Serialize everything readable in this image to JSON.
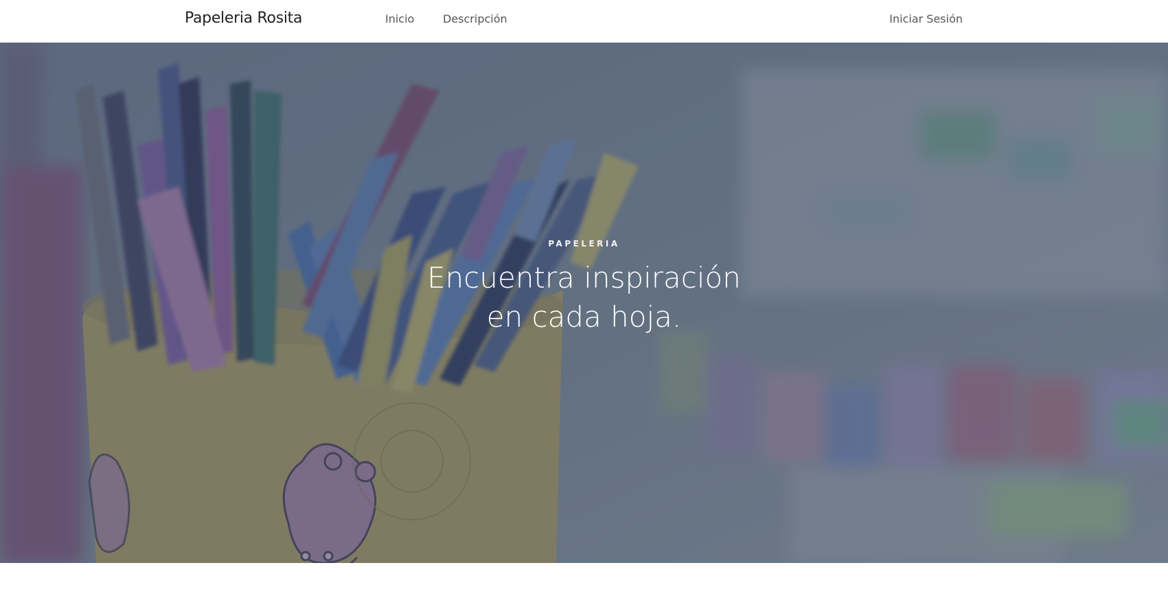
{
  "navbar": {
    "brand": "Papeleria Rosita",
    "links": [
      {
        "label": "Inicio"
      },
      {
        "label": "Descripción"
      }
    ],
    "login_label": "Iniciar Sesión"
  },
  "hero": {
    "eyebrow": "PAPELERIA",
    "headline": "Encuentra inspiración en cada hoja.",
    "overlay_color": "#3c4664"
  }
}
